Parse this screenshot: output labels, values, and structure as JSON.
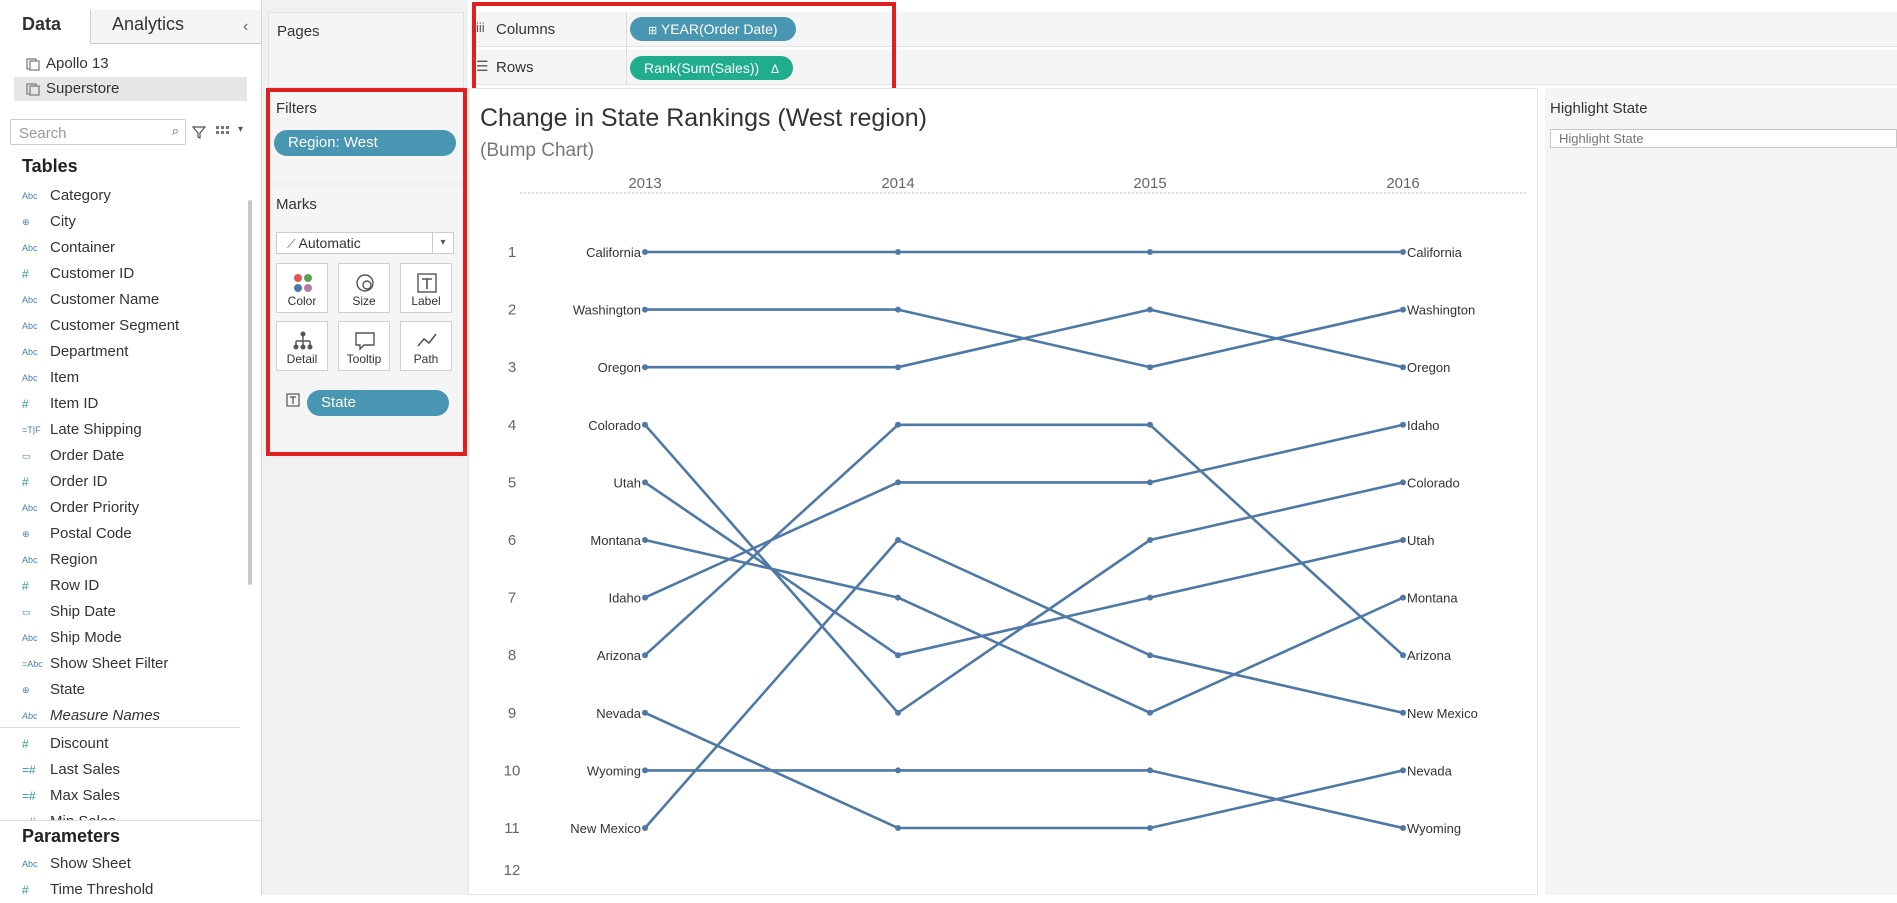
{
  "data_pane": {
    "tabs": [
      "Data",
      "Analytics"
    ],
    "datasources": [
      "Apollo 13",
      "Superstore"
    ],
    "search_placeholder": "Search",
    "tables_title": "Tables",
    "dimensions": [
      {
        "type": "Abc",
        "name": "Category"
      },
      {
        "type": "geo",
        "name": "City"
      },
      {
        "type": "Abc",
        "name": "Container"
      },
      {
        "type": "#",
        "name": "Customer ID"
      },
      {
        "type": "Abc",
        "name": "Customer Name"
      },
      {
        "type": "Abc",
        "name": "Customer Segment"
      },
      {
        "type": "Abc",
        "name": "Department"
      },
      {
        "type": "Abc",
        "name": "Item"
      },
      {
        "type": "#",
        "name": "Item ID"
      },
      {
        "type": "=T|F",
        "name": "Late Shipping"
      },
      {
        "type": "date",
        "name": "Order Date"
      },
      {
        "type": "#",
        "name": "Order ID"
      },
      {
        "type": "Abc",
        "name": "Order Priority"
      },
      {
        "type": "geo",
        "name": "Postal Code"
      },
      {
        "type": "Abc",
        "name": "Region"
      },
      {
        "type": "#",
        "name": "Row ID"
      },
      {
        "type": "date",
        "name": "Ship Date"
      },
      {
        "type": "Abc",
        "name": "Ship Mode"
      },
      {
        "type": "=Abc",
        "name": "Show Sheet Filter"
      },
      {
        "type": "geo",
        "name": "State"
      },
      {
        "type": "Abc",
        "name": "Measure Names",
        "italic": true
      }
    ],
    "measures": [
      {
        "type": "#",
        "name": "Discount"
      },
      {
        "type": "=#",
        "name": "Last Sales"
      },
      {
        "type": "=#",
        "name": "Max Sales"
      },
      {
        "type": "=#",
        "name": "Min Sales"
      }
    ],
    "parameters_title": "Parameters",
    "parameters": [
      {
        "type": "Abc",
        "name": "Show Sheet"
      },
      {
        "type": "#",
        "name": "Time Threshold"
      }
    ]
  },
  "cards": {
    "pages_title": "Pages",
    "filters_title": "Filters",
    "filter_pill": "Region: West",
    "marks_title": "Marks",
    "mark_type": "Automatic",
    "mark_buttons": [
      "Color",
      "Size",
      "Label",
      "Detail",
      "Tooltip",
      "Path"
    ],
    "marks_pill": "State"
  },
  "shelves": {
    "columns_label": "Columns",
    "columns_pill": "YEAR(Order Date)",
    "rows_label": "Rows",
    "rows_pill": "Rank(Sum(Sales))",
    "rows_pill_delta": "Δ"
  },
  "highlight": {
    "title": "Highlight State",
    "placeholder": "Highlight State"
  },
  "chart_data": {
    "type": "line",
    "title": "Change in State Rankings (West region)",
    "subtitle": "(Bump Chart)",
    "x": [
      "2013",
      "2014",
      "2015",
      "2016"
    ],
    "y_ticks": [
      1,
      2,
      3,
      4,
      5,
      6,
      7,
      8,
      9,
      10,
      11,
      12
    ],
    "y_reversed": true,
    "line_color": "#4e79a7",
    "series": [
      {
        "name": "California",
        "values": [
          1,
          1,
          1,
          1
        ]
      },
      {
        "name": "Washington",
        "values": [
          2,
          2,
          3,
          2
        ]
      },
      {
        "name": "Oregon",
        "values": [
          3,
          3,
          2,
          3
        ]
      },
      {
        "name": "Colorado",
        "values": [
          4,
          9,
          6,
          5
        ]
      },
      {
        "name": "Utah",
        "values": [
          5,
          8,
          7,
          6
        ]
      },
      {
        "name": "Montana",
        "values": [
          6,
          7,
          9,
          7
        ]
      },
      {
        "name": "Idaho",
        "values": [
          7,
          5,
          5,
          4
        ]
      },
      {
        "name": "Arizona",
        "values": [
          8,
          4,
          4,
          8
        ]
      },
      {
        "name": "Nevada",
        "values": [
          9,
          11,
          11,
          10
        ]
      },
      {
        "name": "Wyoming",
        "values": [
          10,
          10,
          10,
          11
        ]
      },
      {
        "name": "New Mexico",
        "values": [
          11,
          6,
          8,
          9
        ]
      }
    ]
  }
}
